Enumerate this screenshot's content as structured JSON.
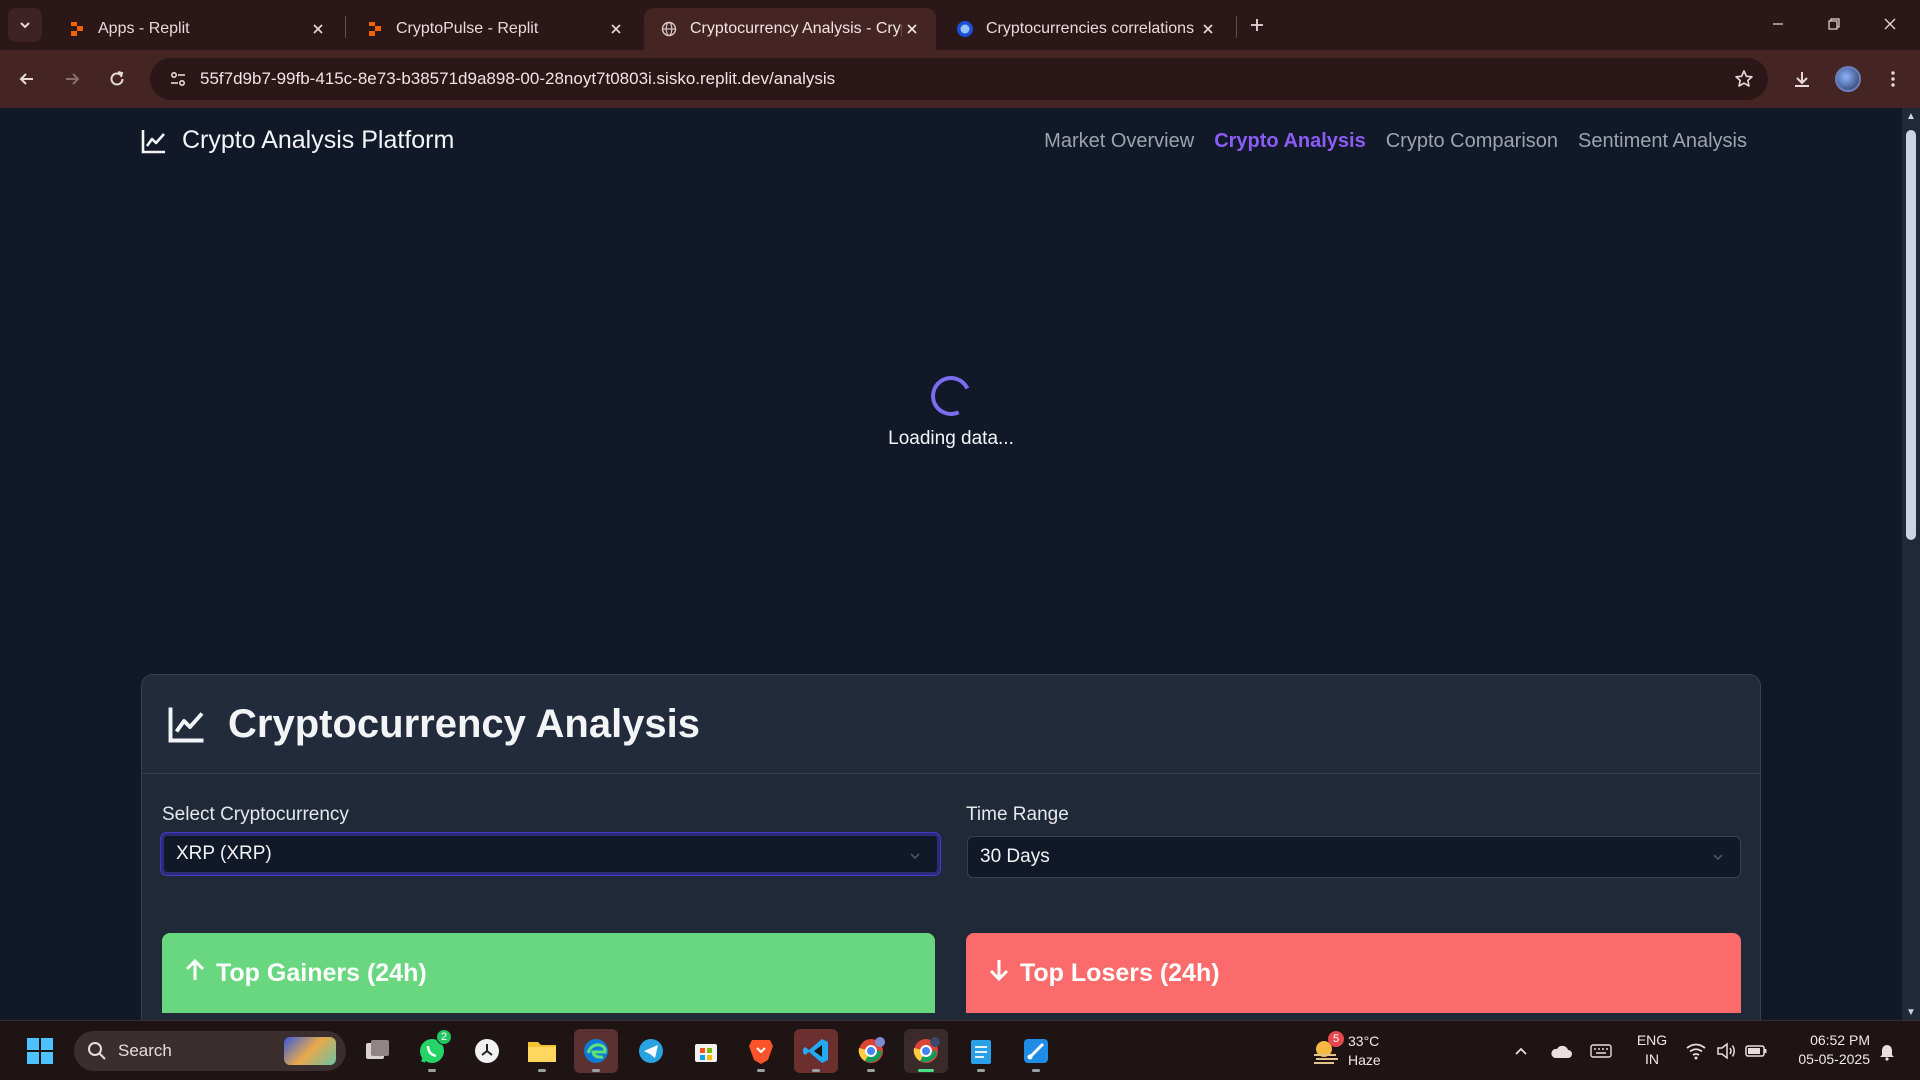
{
  "browser": {
    "tabs": [
      {
        "title": "Apps - Replit",
        "active": false
      },
      {
        "title": "CryptoPulse - Replit",
        "active": false
      },
      {
        "title": "Cryptocurrency Analysis - Crypto",
        "active": true
      },
      {
        "title": "Cryptocurrencies correlations",
        "active": false
      }
    ],
    "url": "55f7d9b7-99fb-415c-8e73-b38571d9a898-00-28noyt7t0803i.sisko.replit.dev/analysis"
  },
  "site": {
    "brand": "Crypto Analysis Platform",
    "nav": [
      {
        "label": "Market Overview",
        "active": false
      },
      {
        "label": "Crypto Analysis",
        "active": true
      },
      {
        "label": "Crypto Comparison",
        "active": false
      },
      {
        "label": "Sentiment Analysis",
        "active": false
      }
    ],
    "loading_text": "Loading data...",
    "card_title": "Cryptocurrency Analysis",
    "select_crypto_label": "Select Cryptocurrency",
    "select_crypto_value": "XRP (XRP)",
    "time_range_label": "Time Range",
    "time_range_value": "30 Days",
    "top_gainers": "Top Gainers (24h)",
    "top_losers": "Top Losers (24h)"
  },
  "taskbar": {
    "search_placeholder": "Search",
    "whatsapp_badge": "2",
    "weather_badge": "5",
    "weather_temp": "33°C",
    "weather_cond": "Haze",
    "lang_line1": "ENG",
    "lang_line2": "IN",
    "time": "06:52 PM",
    "date": "05-05-2025"
  },
  "colors": {
    "accent": "#8b5cf6",
    "gainers": "#68d77f",
    "losers": "#fb6b6b",
    "page_bg": "#111827",
    "card_bg": "#1f2937",
    "browser_frame": "#452424"
  }
}
